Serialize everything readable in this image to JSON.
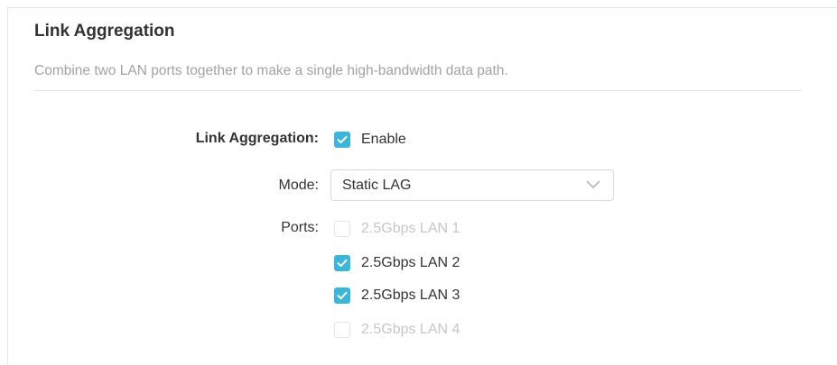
{
  "section": {
    "title": "Link Aggregation",
    "description": "Combine two LAN ports together to make a single high-bandwidth data path."
  },
  "form": {
    "link_aggregation": {
      "label": "Link Aggregation:",
      "option_label": "Enable",
      "checked": true
    },
    "mode": {
      "label": "Mode:",
      "value": "Static LAG"
    },
    "ports": {
      "label": "Ports:",
      "items": [
        {
          "label": "2.5Gbps LAN 1",
          "checked": false,
          "disabled": true
        },
        {
          "label": "2.5Gbps LAN 2",
          "checked": true,
          "disabled": false
        },
        {
          "label": "2.5Gbps LAN 3",
          "checked": true,
          "disabled": false
        },
        {
          "label": "2.5Gbps LAN 4",
          "checked": false,
          "disabled": true
        }
      ]
    }
  },
  "colors": {
    "accent": "#3bb6d8",
    "text": "#333333",
    "muted": "#a3a3a3",
    "disabled": "#c6c6c6"
  },
  "icons": {
    "checkbox_checked": "checkmark-icon",
    "select_arrow": "chevron-down-icon"
  }
}
